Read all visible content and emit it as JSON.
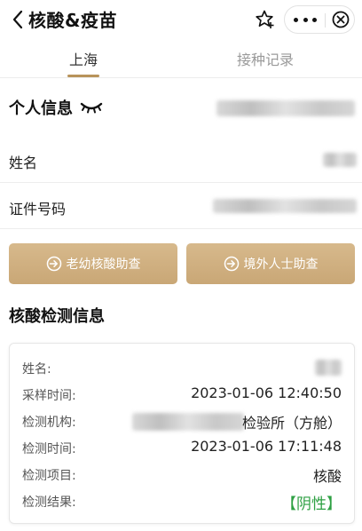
{
  "header": {
    "title": "核酸&疫苗",
    "back_icon": "chevron-left-icon",
    "favorite_icon": "star-plus-icon",
    "more_icon": "more-dots-icon",
    "close_icon": "close-circle-icon"
  },
  "tabs": [
    {
      "label": "上海",
      "active": true
    },
    {
      "label": "接种记录",
      "active": false
    }
  ],
  "personal": {
    "title": "个人信息",
    "toggle_icon": "eye-closed-icon",
    "fields": [
      {
        "label": "姓名"
      },
      {
        "label": "证件号码"
      }
    ]
  },
  "actions": [
    {
      "label": "老幼核酸助查",
      "icon": "arrow-circle-icon"
    },
    {
      "label": "境外人士助查",
      "icon": "arrow-circle-icon"
    }
  ],
  "test": {
    "title": "核酸检测信息",
    "rows": [
      {
        "label": "姓名:",
        "value": ""
      },
      {
        "label": "采样时间:",
        "value": "2023-01-06 12:40:50"
      },
      {
        "label": "检测机构:",
        "value": "检验所（方舱）"
      },
      {
        "label": "检测时间:",
        "value": "2023-01-06 17:11:48"
      },
      {
        "label": "检测项目:",
        "value": "核酸"
      },
      {
        "label": "检测结果:",
        "value": "【阴性】"
      }
    ]
  },
  "colors": {
    "gold": "#c9a776",
    "tab_active_line": "#b8935a",
    "negative_green": "#2ea043"
  }
}
